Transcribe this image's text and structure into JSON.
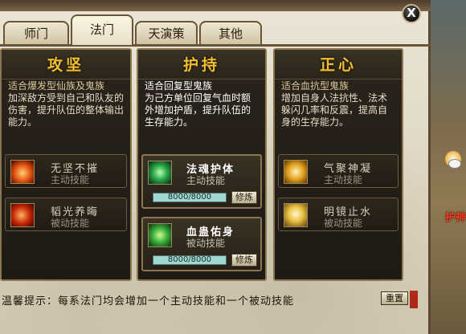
{
  "window": {
    "close_label": "X"
  },
  "tabs": [
    {
      "label": "师门",
      "active": false
    },
    {
      "label": "法门",
      "active": true
    },
    {
      "label": "天演策",
      "active": false
    },
    {
      "label": "其他",
      "active": false
    }
  ],
  "columns": [
    {
      "title": "攻坚",
      "desc_line1": "适合爆发型仙族及鬼族",
      "desc_rest": "加深敌方受到自己和队友的伤害，提升队伍的整体输出能力。",
      "skills": [
        {
          "name": "无坚不摧",
          "type": "主动技能",
          "icon": "flame-warrior-icon"
        },
        {
          "name": "韬光养晦",
          "type": "被动技能",
          "icon": "fire-aura-icon"
        }
      ]
    },
    {
      "title": "护持",
      "desc_line1": "适合回复型鬼族",
      "desc_rest": "为己方单位回复气血时额外增加护盾，提升队伍的生存能力。",
      "skills": [
        {
          "name": "法魂护体",
          "type": "主动技能",
          "icon": "green-spirit-icon",
          "progress": "8000/8000",
          "button": "修炼"
        },
        {
          "name": "血蛊佑身",
          "type": "被动技能",
          "icon": "green-swirl-icon",
          "progress": "8000/8000",
          "button": "修炼"
        }
      ]
    },
    {
      "title": "正心",
      "desc_line1": "适合血抗型鬼族",
      "desc_rest": "增加自身人法抗性、法术躲闪几率和反震，提高自身的生存能力。",
      "skills": [
        {
          "name": "气聚神凝",
          "type": "主动技能",
          "icon": "golden-meditation-icon"
        },
        {
          "name": "明镜止水",
          "type": "被动技能",
          "icon": "golden-light-icon"
        }
      ]
    }
  ],
  "footer": {
    "tip": "温馨提示：每系法门均会增加一个主动技能和一个被动技能",
    "reset_label": "重置"
  },
  "background": {
    "side_text": "护神"
  },
  "colors": {
    "title_gold": "#f0c030",
    "panel_dark": "#201b14",
    "progress_fill": "#9fd7d1"
  }
}
